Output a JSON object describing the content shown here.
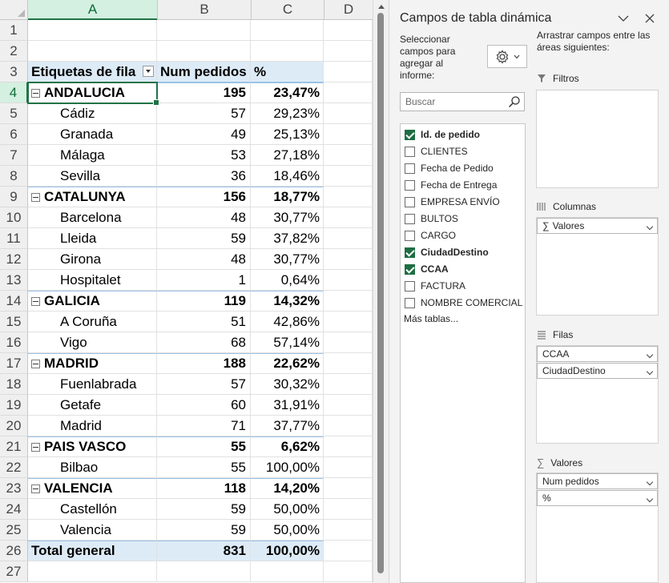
{
  "sheet": {
    "columns": [
      "A",
      "B",
      "C",
      "D"
    ],
    "header": {
      "row": "3",
      "label": "Etiquetas de fila",
      "count": "Num pedidos",
      "pct": "%"
    },
    "empty_rows_top": [
      "1",
      "2"
    ],
    "rows": [
      {
        "row": "4",
        "type": "group",
        "label": "ANDALUCIA",
        "count": "195",
        "pct": "23,47%"
      },
      {
        "row": "5",
        "type": "child",
        "label": "Cádiz",
        "count": "57",
        "pct": "29,23%"
      },
      {
        "row": "6",
        "type": "child",
        "label": "Granada",
        "count": "49",
        "pct": "25,13%"
      },
      {
        "row": "7",
        "type": "child",
        "label": "Málaga",
        "count": "53",
        "pct": "27,18%"
      },
      {
        "row": "8",
        "type": "child",
        "label": "Sevilla",
        "count": "36",
        "pct": "18,46%"
      },
      {
        "row": "9",
        "type": "group",
        "label": "CATALUNYA",
        "count": "156",
        "pct": "18,77%"
      },
      {
        "row": "10",
        "type": "child",
        "label": "Barcelona",
        "count": "48",
        "pct": "30,77%"
      },
      {
        "row": "11",
        "type": "child",
        "label": "Lleida",
        "count": "59",
        "pct": "37,82%"
      },
      {
        "row": "12",
        "type": "child",
        "label": "Girona",
        "count": "48",
        "pct": "30,77%"
      },
      {
        "row": "13",
        "type": "child",
        "label": "Hospitalet",
        "count": "1",
        "pct": "0,64%"
      },
      {
        "row": "14",
        "type": "group",
        "label": "GALICIA",
        "count": "119",
        "pct": "14,32%"
      },
      {
        "row": "15",
        "type": "child",
        "label": "A Coruña",
        "count": "51",
        "pct": "42,86%"
      },
      {
        "row": "16",
        "type": "child",
        "label": "Vigo",
        "count": "68",
        "pct": "57,14%"
      },
      {
        "row": "17",
        "type": "group",
        "label": "MADRID",
        "count": "188",
        "pct": "22,62%"
      },
      {
        "row": "18",
        "type": "child",
        "label": "Fuenlabrada",
        "count": "57",
        "pct": "30,32%"
      },
      {
        "row": "19",
        "type": "child",
        "label": "Getafe",
        "count": "60",
        "pct": "31,91%"
      },
      {
        "row": "20",
        "type": "child",
        "label": "Madrid",
        "count": "71",
        "pct": "37,77%"
      },
      {
        "row": "21",
        "type": "group",
        "label": "PAIS VASCO",
        "count": "55",
        "pct": "6,62%"
      },
      {
        "row": "22",
        "type": "child",
        "label": "Bilbao",
        "count": "55",
        "pct": "100,00%"
      },
      {
        "row": "23",
        "type": "group",
        "label": "VALENCIA",
        "count": "118",
        "pct": "14,20%"
      },
      {
        "row": "24",
        "type": "child",
        "label": "Castellón",
        "count": "59",
        "pct": "50,00%"
      },
      {
        "row": "25",
        "type": "child",
        "label": "Valencia",
        "count": "59",
        "pct": "50,00%"
      },
      {
        "row": "26",
        "type": "total",
        "label": "Total general",
        "count": "831",
        "pct": "100,00%"
      },
      {
        "row": "27",
        "type": "empty",
        "label": "",
        "count": "",
        "pct": ""
      }
    ]
  },
  "pane": {
    "title": "Campos de tabla dinámica",
    "select_label": "Seleccionar campos para agregar al informe:",
    "drag_label": "Arrastrar campos entre las áreas siguientes:",
    "search_placeholder": "Buscar",
    "fields": [
      {
        "label": "Id. de pedido",
        "checked": true
      },
      {
        "label": "CLIENTES",
        "checked": false
      },
      {
        "label": "Fecha de Pedido",
        "checked": false
      },
      {
        "label": "Fecha de Entrega",
        "checked": false
      },
      {
        "label": "EMPRESA ENVÍO",
        "checked": false
      },
      {
        "label": "BULTOS",
        "checked": false
      },
      {
        "label": "CARGO",
        "checked": false
      },
      {
        "label": "CiudadDestino",
        "checked": true
      },
      {
        "label": "CCAA",
        "checked": true
      },
      {
        "label": "FACTURA",
        "checked": false
      },
      {
        "label": "NOMBRE COMERCIAL",
        "checked": false
      }
    ],
    "more_tables": "Más tablas...",
    "areas": {
      "filters": {
        "title": "Filtros",
        "items": []
      },
      "columns": {
        "title": "Columnas",
        "items": [
          "Valores"
        ]
      },
      "rows": {
        "title": "Filas",
        "items": [
          "CCAA",
          "CiudadDestino"
        ]
      },
      "values": {
        "title": "Valores",
        "items": [
          "Num pedidos",
          "%"
        ]
      }
    }
  },
  "colors": {
    "accent": "#217346",
    "pivot_header": "#ddebf7",
    "pivot_border": "#9bc2e6"
  }
}
